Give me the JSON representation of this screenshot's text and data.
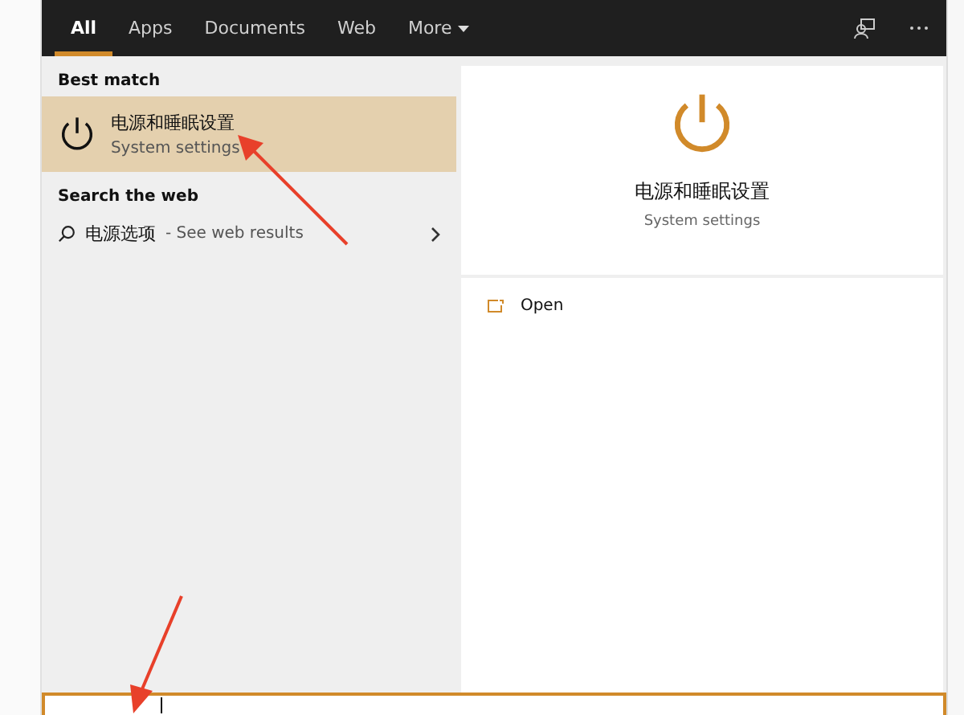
{
  "tabs": [
    {
      "label": "All",
      "selected": true
    },
    {
      "label": "Apps",
      "selected": false
    },
    {
      "label": "Documents",
      "selected": false
    },
    {
      "label": "Web",
      "selected": false
    },
    {
      "label": "More",
      "selected": false,
      "kind": "dropdown"
    }
  ],
  "best_match": {
    "heading": "Best match",
    "title": "电源和睡眠设置",
    "subtitle": "System settings",
    "selected": true
  },
  "web_search": {
    "heading": "Search the web",
    "query": "电源选项",
    "hint": " - See web results"
  },
  "preview": {
    "title": "电源和睡眠设置",
    "subtitle": "System settings",
    "actions": [
      {
        "label": "Open"
      }
    ]
  },
  "search_box": {
    "focused": true
  }
}
